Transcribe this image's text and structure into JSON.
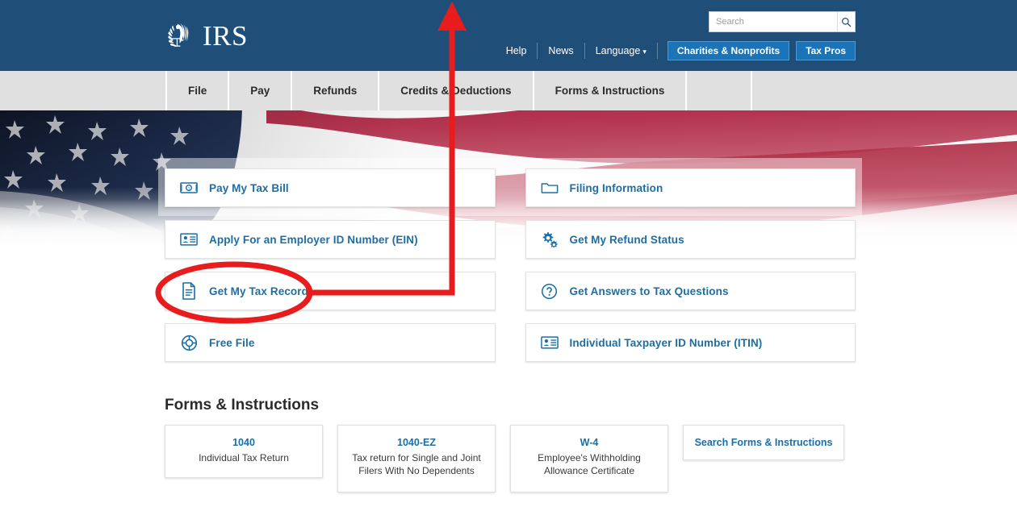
{
  "brand": {
    "name": "IRS",
    "seal_icon": "irs-eagle-scales-seal",
    "header_bg": "#1f4f79",
    "link_color": "#1c6ea4",
    "button_bg": "#1c74b8"
  },
  "search": {
    "placeholder": "Search",
    "value": "",
    "icon": "search-icon"
  },
  "utility_nav": {
    "links": [
      {
        "label": "Help"
      },
      {
        "label": "News"
      },
      {
        "label": "Language",
        "caret": "⌄"
      }
    ],
    "buttons": [
      {
        "label": "Charities & Nonprofits"
      },
      {
        "label": "Tax Pros"
      }
    ]
  },
  "main_nav": {
    "items": [
      {
        "label": "File"
      },
      {
        "label": "Pay"
      },
      {
        "label": "Refunds"
      },
      {
        "label": "Credits & Deductions"
      },
      {
        "label": "Forms & Instructions"
      }
    ]
  },
  "quick_links": {
    "left_column": [
      {
        "label": "Pay My Tax Bill",
        "icon": "money-bill-icon"
      },
      {
        "label": "Apply For an Employer ID Number (EIN)",
        "icon": "id-card-icon"
      },
      {
        "label": "Get My Tax Record",
        "icon": "document-icon"
      },
      {
        "label": "Free File",
        "icon": "life-ring-icon"
      }
    ],
    "right_column": [
      {
        "label": "Filing Information",
        "icon": "folder-icon"
      },
      {
        "label": "Get My Refund Status",
        "icon": "gears-icon"
      },
      {
        "label": "Get Answers to Tax Questions",
        "icon": "question-circle-icon"
      },
      {
        "label": "Individual Taxpayer ID Number (ITIN)",
        "icon": "id-card-icon"
      }
    ]
  },
  "forms_section": {
    "heading": "Forms & Instructions",
    "cards": [
      {
        "number": "1040",
        "description": "Individual Tax Return"
      },
      {
        "number": "1040-EZ",
        "description": "Tax return for Single and Joint Filers With No Dependents"
      },
      {
        "number": "W-4",
        "description": "Employee's Withholding Allowance Certificate"
      }
    ],
    "search_link": "Search Forms & Instructions"
  },
  "annotation": {
    "highlight_color": "#e81c1c",
    "ellipse_target": "Get My Tax Record",
    "arrow_target": "Credits & Deductions"
  }
}
